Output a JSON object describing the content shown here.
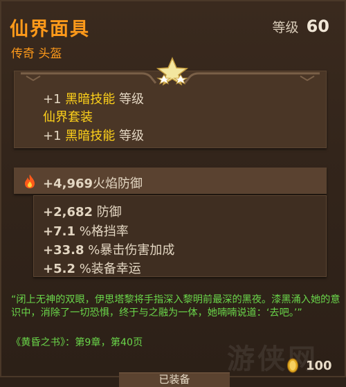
{
  "item": {
    "name": "仙界面具",
    "subtitle": "传奇 头盔",
    "level_label": "等级",
    "level_value": "60"
  },
  "set_bonus": {
    "line1_prefix": "+1",
    "line1_skill": "黑暗技能",
    "line1_suffix": "等级",
    "set_name": "仙界套装",
    "line2_prefix": "+1",
    "line2_skill": "黑暗技能",
    "line2_suffix": "等级"
  },
  "primary_stat": {
    "value": "+4,969",
    "label": "火焰防御"
  },
  "secondary_stats": [
    {
      "value": "+2,682",
      "label": "防御"
    },
    {
      "value": "+7.1",
      "label": "%格挡率"
    },
    {
      "value": "+33.8",
      "label": "%暴击伤害加成"
    },
    {
      "value": "+5.2",
      "label": "%装备幸运"
    }
  ],
  "lore": {
    "text": "“闭上无神的双眼，伊思塔黎将手指深入黎明前最深的黑夜。漆黑涌入她的意识中，消除了一切恐惧，终于与之融为一体，她喃喃说道：‘去吧。’”",
    "source": "《黄昏之书》：第9章，第40页"
  },
  "price": "100",
  "equip_button": "已装备",
  "watermark": "游侠网",
  "colors": {
    "legendary": "#ff9a1a",
    "skill_highlight": "#ffd21a",
    "lore_green": "#6ad64a"
  }
}
